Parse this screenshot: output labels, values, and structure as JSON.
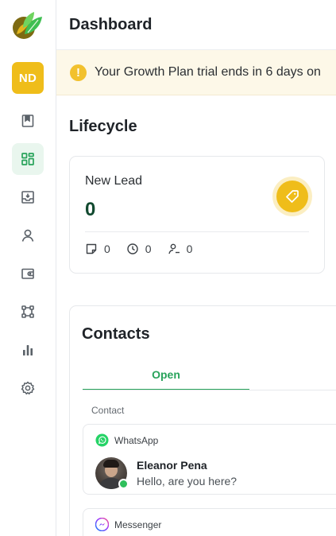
{
  "app": {
    "page_title": "Dashboard",
    "user_initials": "ND",
    "accent_color": "#28a35b",
    "avatar_color": "#efbd1a"
  },
  "sidebar": {
    "items": [
      {
        "icon": "bookmark-icon"
      },
      {
        "icon": "dashboard-grid-icon",
        "active": true
      },
      {
        "icon": "inbox-download-icon"
      },
      {
        "icon": "user-icon"
      },
      {
        "icon": "wallet-icon"
      },
      {
        "icon": "workflow-icon"
      },
      {
        "icon": "bar-chart-icon"
      },
      {
        "icon": "gear-icon"
      }
    ]
  },
  "banner": {
    "icon": "!",
    "text": "Your Growth Plan trial ends in 6 days on"
  },
  "lifecycle": {
    "title": "Lifecycle",
    "stage": {
      "name": "New Lead",
      "count": "0",
      "icon": "tag-icon",
      "stats": {
        "notes": "0",
        "pending": "0",
        "assigned": "0"
      }
    }
  },
  "contacts": {
    "title": "Contacts",
    "active_tab": "Open",
    "column_header": "Contact",
    "conversations": [
      {
        "channel": "WhatsApp",
        "channel_color": "#25d366",
        "name": "Eleanor Pena",
        "message": "Hello, are you here?",
        "online": true
      },
      {
        "channel": "Messenger",
        "channel_color": "#a334fa"
      }
    ]
  }
}
